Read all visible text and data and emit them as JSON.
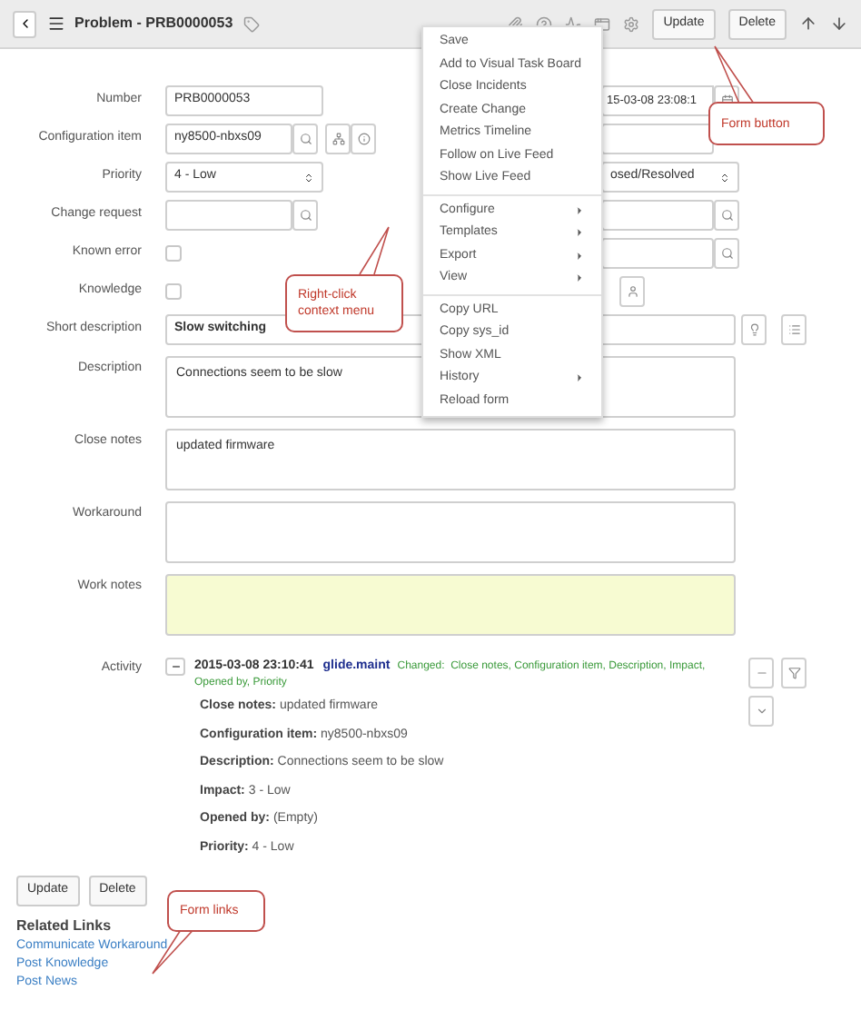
{
  "header": {
    "title": "Problem - PRB0000053",
    "buttons": [
      "Update",
      "Delete"
    ]
  },
  "form": {
    "rows": [
      {
        "label": "Number",
        "kind": "text",
        "value": "PRB0000053",
        "right": {
          "kind": "date",
          "value": "15-03-08 23:08:1"
        }
      },
      {
        "label": "Configuration item",
        "kind": "reference",
        "value": "ny8500-nbxs09",
        "right": {
          "kind": "field"
        }
      },
      {
        "label": "Priority",
        "kind": "select",
        "value": "4 - Low",
        "right": {
          "kind": "select",
          "value": "osed/Resolved"
        }
      },
      {
        "label": "Change request",
        "kind": "lookup",
        "value": "",
        "right": {
          "kind": "lookup"
        }
      },
      {
        "label": "Known error",
        "kind": "checkbox",
        "checked": false,
        "right": {
          "kind": "lookup"
        }
      },
      {
        "label": "Knowledge",
        "kind": "checkbox",
        "checked": false,
        "right": {
          "kind": "user"
        }
      },
      {
        "label": "Short description",
        "kind": "wide",
        "value": "Slow switching"
      },
      {
        "label": "Description",
        "kind": "textarea",
        "value": "Connections seem to be slow"
      },
      {
        "label": "Close notes",
        "kind": "textarea",
        "value": "updated firmware"
      },
      {
        "label": "Workaround",
        "kind": "textarea",
        "value": ""
      },
      {
        "label": "Work notes",
        "kind": "journal",
        "value": ""
      }
    ]
  },
  "activity": {
    "label": "Activity",
    "entries": [
      {
        "time": "2015-03-08 23:10:41",
        "user": "glide.maint",
        "summary": "Changed:  Close notes, Configuration item, Description, Impact, Opened by, Priority",
        "changes": [
          {
            "field": "Close notes:",
            "value": "updated firmware"
          },
          {
            "field": "Configuration item:",
            "value": "ny8500-nbxs09"
          },
          {
            "field": "Description:",
            "value": "Connections seem to be slow"
          },
          {
            "field": "Impact:",
            "value": "3 - Low"
          },
          {
            "field": "Opened by:",
            "value": "(Empty)"
          },
          {
            "field": "Priority:",
            "value": "4 - Low"
          }
        ]
      }
    ]
  },
  "footer": {
    "buttons": [
      "Update",
      "Delete"
    ],
    "related_title": "Related Links",
    "links": [
      "Communicate Workaround",
      "Post Knowledge",
      "Post News"
    ]
  },
  "context_menu": [
    {
      "kind": "item",
      "label": "Save",
      "submenu": false
    },
    {
      "kind": "item",
      "label": "Add to Visual Task Board",
      "submenu": false
    },
    {
      "kind": "item",
      "label": "Close Incidents",
      "submenu": false
    },
    {
      "kind": "item",
      "label": "Create Change",
      "submenu": false
    },
    {
      "kind": "item",
      "label": "Metrics Timeline",
      "submenu": false
    },
    {
      "kind": "item",
      "label": "Follow on Live Feed",
      "submenu": false
    },
    {
      "kind": "item",
      "label": "Show Live Feed",
      "submenu": false
    },
    {
      "kind": "divider"
    },
    {
      "kind": "item",
      "label": "Configure",
      "submenu": true
    },
    {
      "kind": "item",
      "label": "Templates",
      "submenu": true
    },
    {
      "kind": "item",
      "label": "Export",
      "submenu": true
    },
    {
      "kind": "item",
      "label": "View",
      "submenu": true
    },
    {
      "kind": "divider"
    },
    {
      "kind": "item",
      "label": "Copy URL",
      "submenu": false
    },
    {
      "kind": "item",
      "label": "Copy sys_id",
      "submenu": false
    },
    {
      "kind": "item",
      "label": "Show XML",
      "submenu": false
    },
    {
      "kind": "item",
      "label": "History",
      "submenu": true
    },
    {
      "kind": "item",
      "label": "Reload form",
      "submenu": false
    }
  ],
  "callouts": [
    {
      "kind": "button",
      "text": "Form button"
    },
    {
      "kind": "menu",
      "text": "Right-click context menu"
    },
    {
      "kind": "links",
      "text": "Form links"
    }
  ]
}
